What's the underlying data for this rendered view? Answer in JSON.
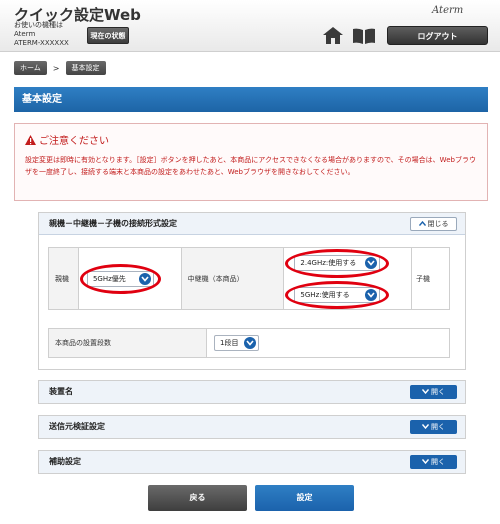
{
  "header": {
    "app_title": "クイック設定Web",
    "model_caption": "お使いの機種は",
    "brand_line": "Aterm",
    "model_name": "ATERM-XXXXXX",
    "status_button": "現在の状態",
    "logo": "Aterm",
    "logout_button": "ログアウト",
    "home_icon": "home-icon",
    "manual_icon": "book-icon"
  },
  "breadcrumb": {
    "home": "ホーム",
    "separator": ">",
    "current": "基本設定"
  },
  "page_title": "基本設定",
  "warning": {
    "heading": "ご注意ください",
    "text": "設定変更は即時に有効となります。［設定］ボタンを押したあと、本商品にアクセスできなくなる場合がありますので、その場合は、Webブラウザを一度終了し、接続する端末と本商品の設定をあわせたあと、Webブラウザを開きなおしてください。"
  },
  "connection": {
    "title": "親機－中継機－子機の接続形式設定",
    "close_button": "閉じる",
    "parent_label": "親機",
    "parent_select": "5GHz優先",
    "repeater_label": "中継機（本商品）",
    "repeater_24_select": "2.4GHz:使用する",
    "repeater_5_select": "5GHz:使用する",
    "child_label": "子機",
    "stages_label": "本商品の設置段数",
    "stages_select": "1段目"
  },
  "sections": [
    {
      "title": "装置名",
      "open_button": "開く"
    },
    {
      "title": "送信元検証設定",
      "open_button": "開く"
    },
    {
      "title": "補助設定",
      "open_button": "開く"
    }
  ],
  "footer": {
    "back_button": "戻る",
    "apply_button": "設定"
  },
  "colors": {
    "accent_blue": "#1b62ac",
    "warning_red": "#c21b1b",
    "highlight_red": "#e00010"
  }
}
